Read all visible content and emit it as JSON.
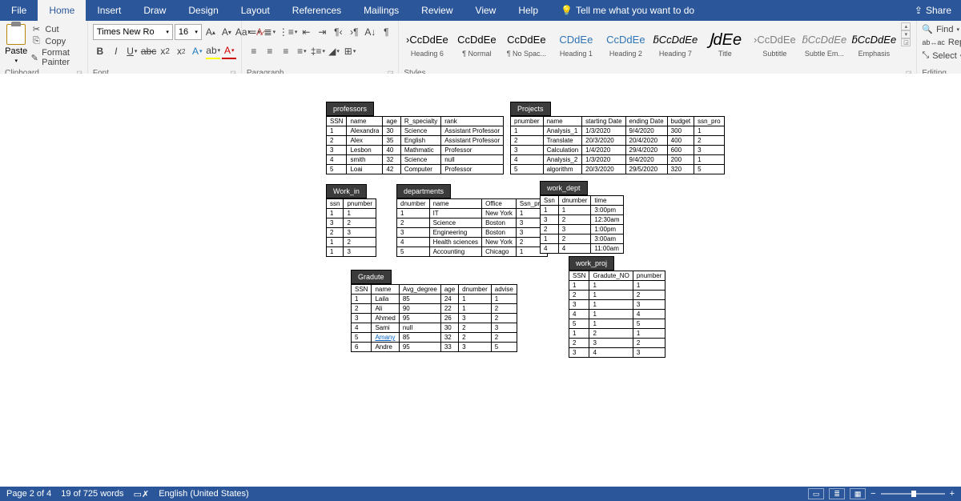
{
  "tabs": [
    "File",
    "Home",
    "Insert",
    "Draw",
    "Design",
    "Layout",
    "References",
    "Mailings",
    "Review",
    "View",
    "Help"
  ],
  "active_tab": "Home",
  "tell_me": "Tell me what you want to do",
  "share": "Share",
  "clipboard": {
    "paste": "Paste",
    "cut": "Cut",
    "copy": "Copy",
    "format_painter": "Format Painter",
    "group": "Clipboard"
  },
  "font": {
    "name": "Times New Ro",
    "size": "16",
    "group": "Font"
  },
  "paragraph": {
    "group": "Paragraph"
  },
  "styles": {
    "group": "Styles",
    "items": [
      {
        "preview": "›CcDdEe",
        "name": "Heading 6",
        "cls": ""
      },
      {
        "preview": "CcDdEe",
        "name": "¶ Normal",
        "cls": ""
      },
      {
        "preview": "CcDdEe",
        "name": "¶ No Spac...",
        "cls": ""
      },
      {
        "preview": "CDdEe",
        "name": "Heading 1",
        "cls": "c2e74b5"
      },
      {
        "preview": "CcDdEe",
        "name": "Heading 2",
        "cls": "c2e74b5"
      },
      {
        "preview": "ƃCcDdEe",
        "name": "Heading 7",
        "cls": "i"
      },
      {
        "preview": "ͿdEe",
        "name": "Title",
        "cls": "big"
      },
      {
        "preview": "›CcDdEe",
        "name": "Subtitle",
        "cls": "gray"
      },
      {
        "preview": "ƃCcDdEe",
        "name": "Subtle Em...",
        "cls": "i gray"
      },
      {
        "preview": "ƃCcDdEe",
        "name": "Emphasis",
        "cls": "i"
      }
    ]
  },
  "editing": {
    "find": "Find",
    "replace": "Replace",
    "select": "Select",
    "group": "Editing"
  },
  "status": {
    "page": "Page 2 of 4",
    "words": "19 of 725 words",
    "lang": "English (United States)",
    "zoom_plus": "+"
  },
  "doc": {
    "professors": {
      "title": "professors",
      "head": [
        "SSN",
        "name",
        "age",
        "R_specialty",
        "rank"
      ],
      "rows": [
        [
          "1",
          "Alexandra",
          "30",
          "Science",
          "Assistant Professor"
        ],
        [
          "2",
          "Alex",
          "35",
          "English",
          "Assistant Professor"
        ],
        [
          "3",
          "Lesbon",
          "40",
          "Mathmatic",
          "Professor"
        ],
        [
          "4",
          "smith",
          "32",
          "Science",
          "null"
        ],
        [
          "5",
          "Loai",
          "42",
          "Computer",
          "Professor"
        ]
      ]
    },
    "projects": {
      "title": "Projects",
      "head": [
        "pnumber",
        "name",
        "starting Date",
        "ending Date",
        "budget",
        "ssn_pro"
      ],
      "rows": [
        [
          "1",
          "Analysis_1",
          "1/3/2020",
          "9/4/2020",
          "300",
          "1"
        ],
        [
          "2",
          "Translate",
          "20/3/2020",
          "20/4/2020",
          "400",
          "2"
        ],
        [
          "3",
          "Calculation",
          "1/4/2020",
          "29/4/2020",
          "600",
          "3"
        ],
        [
          "4",
          "Analysis_2",
          "1/3/2020",
          "9/4/2020",
          "200",
          "1"
        ],
        [
          "5",
          "algorithm",
          "20/3/2020",
          "29/5/2020",
          "320",
          "5"
        ]
      ]
    },
    "work_in": {
      "title": "Work_in",
      "head": [
        "ssn",
        "pnumber"
      ],
      "rows": [
        [
          "1",
          "1"
        ],
        [
          "3",
          "2"
        ],
        [
          "2",
          "3"
        ],
        [
          "1",
          "2"
        ],
        [
          "1",
          "3"
        ]
      ]
    },
    "departments": {
      "title": "departments",
      "head": [
        "dnumber",
        "name",
        "Office",
        "Ssn_pro"
      ],
      "rows": [
        [
          "1",
          "IT",
          "New York",
          "1"
        ],
        [
          "2",
          "Science",
          "Boston",
          "3"
        ],
        [
          "3",
          "Engineering",
          "Boston",
          "3"
        ],
        [
          "4",
          "Health sciences",
          "New York",
          "2"
        ],
        [
          "5",
          "Accounting",
          "Chicago",
          "1"
        ]
      ]
    },
    "work_dept": {
      "title": "work_dept",
      "head": [
        "Ssn",
        "dnumber",
        "time"
      ],
      "rows": [
        [
          "1",
          "1",
          "3:00pm"
        ],
        [
          "3",
          "2",
          "12:30am"
        ],
        [
          "2",
          "3",
          "1:00pm"
        ],
        [
          "1",
          "2",
          "3:00am"
        ],
        [
          "4",
          "4",
          "11:00am"
        ]
      ]
    },
    "gradute": {
      "title": "Gradute",
      "head": [
        "SSN",
        "name",
        "Avg_degree",
        "age",
        "dnumber",
        "advise"
      ],
      "rows": [
        [
          "1",
          "Laila",
          "85",
          "24",
          "1",
          "1"
        ],
        [
          "2",
          "Ali",
          "90",
          "22",
          "1",
          "2"
        ],
        [
          "3",
          "Ahmed",
          "95",
          "26",
          "3",
          "2"
        ],
        [
          "4",
          "Sami",
          "null",
          "30",
          "2",
          "3"
        ],
        [
          "5",
          "Amany",
          "85",
          "32",
          "2",
          "2",
          "link"
        ],
        [
          "6",
          "Andre",
          "95",
          "33",
          "3",
          "5"
        ]
      ]
    },
    "work_proj": {
      "title": "work_proj",
      "head": [
        "SSN",
        "Gradute_NO",
        "pnumber"
      ],
      "rows": [
        [
          "1",
          "1",
          "1"
        ],
        [
          "2",
          "1",
          "2"
        ],
        [
          "3",
          "1",
          "3"
        ],
        [
          "4",
          "1",
          "4"
        ],
        [
          "5",
          "1",
          "5"
        ],
        [
          "1",
          "2",
          "1"
        ],
        [
          "2",
          "3",
          "2"
        ],
        [
          "3",
          "4",
          "3"
        ]
      ]
    }
  }
}
